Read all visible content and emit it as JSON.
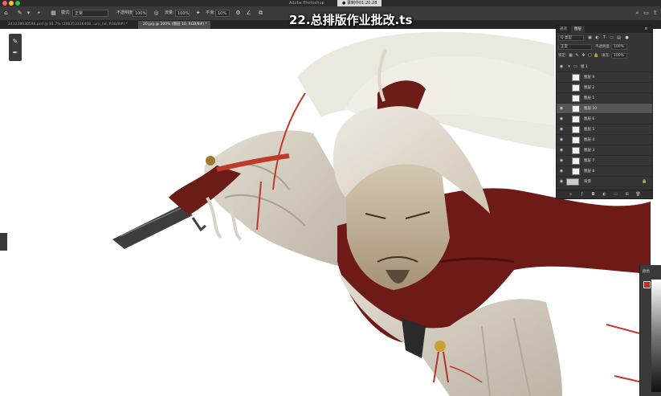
{
  "window": {
    "title": "Adobe Photoshop",
    "recording": "● 录制中01:20:28",
    "traffic_colors": [
      "#ff5f57",
      "#febc2e",
      "#28c840"
    ]
  },
  "options_bar": {
    "mode_label": "模式:",
    "mode_value": "正常",
    "opacity_label": "不透明度:",
    "opacity_value": "100%",
    "flow_label": "流量:",
    "flow_value": "100%",
    "smooth_label": "平滑:",
    "smooth_value": "10%"
  },
  "tabs": [
    {
      "label": "243228930596.psd @ 81.7% (208353336408...ure_hd, RGB/8#) *",
      "active": false
    },
    {
      "label": "20.jpg @ 300% (图层 10, RGB/8#) *",
      "active": true
    }
  ],
  "overlay_title": "22.总排版作业批改.ts",
  "layers_panel": {
    "tabs": [
      "通道",
      "图层"
    ],
    "filter_label": "Q 类型",
    "blend_mode": "正常",
    "opacity_label": "不透明度:",
    "opacity_value": "100%",
    "lock_label": "锁定:",
    "fill_label": "填充:",
    "fill_value": "100%",
    "group_name": "组 1",
    "layers": [
      {
        "name": "图层 9",
        "visible": false,
        "selected": false
      },
      {
        "name": "图层 2",
        "visible": false,
        "selected": false
      },
      {
        "name": "图层 1",
        "visible": false,
        "selected": false
      },
      {
        "name": "图层 10",
        "visible": true,
        "selected": true
      },
      {
        "name": "图层 6",
        "visible": true,
        "selected": false
      },
      {
        "name": "图层 5",
        "visible": true,
        "selected": false
      },
      {
        "name": "图层 4",
        "visible": true,
        "selected": false
      },
      {
        "name": "图层 3",
        "visible": true,
        "selected": false
      },
      {
        "name": "图层 7",
        "visible": true,
        "selected": false
      },
      {
        "name": "图层 8",
        "visible": true,
        "selected": false
      }
    ],
    "background_name": "背景",
    "bottom_icons": [
      "link-icon",
      "fx-icon",
      "mask-icon",
      "adjustment-icon",
      "folder-icon",
      "new-layer-icon",
      "trash-icon"
    ]
  },
  "color_panel": {
    "label": "颜色",
    "swatch_color": "#c42a2a"
  }
}
